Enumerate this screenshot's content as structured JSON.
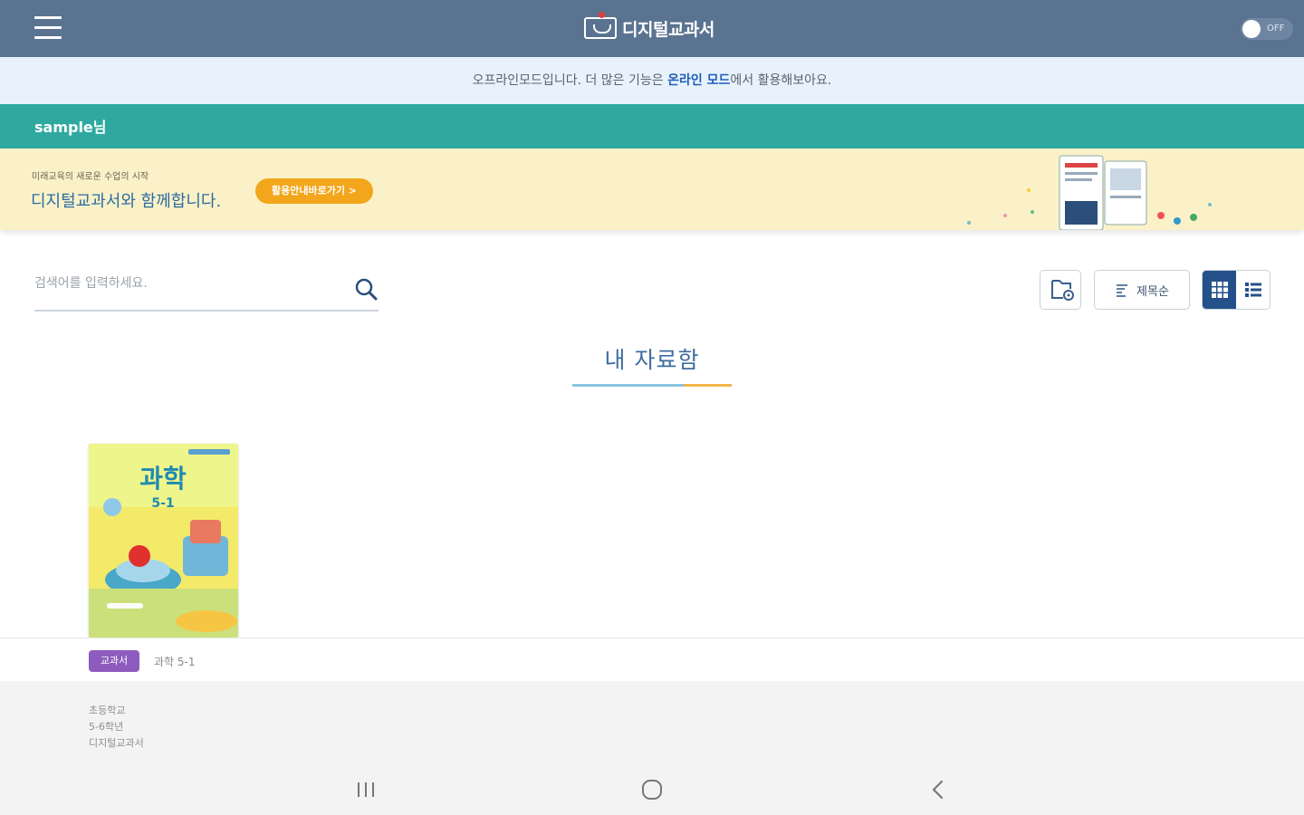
{
  "header": {
    "app_title": "디지털교과서",
    "toggle_label": "OFF"
  },
  "notice": {
    "prefix": "오프라인모드입니다. 더 많은 기능은 ",
    "link": "온라인 모드",
    "suffix": "에서 활용해보아요."
  },
  "user": {
    "name": "sample님"
  },
  "banner": {
    "small_text": "미래교육의 새로운 수업의 시작",
    "headline": "디지털교과서와 함께합니다.",
    "cta": "활용안내바로가기 >"
  },
  "search": {
    "placeholder": "검색어를 입력하세요."
  },
  "toolbar": {
    "sort_label": "제목순",
    "view_mode": "grid"
  },
  "section": {
    "title": "내 자료함"
  },
  "books": [
    {
      "cover_title": "과학",
      "cover_grade": "5-1",
      "badge": "교과서",
      "name": "과학 5-1",
      "details": [
        "초등학교",
        "5-6학년",
        "디지털교과서"
      ]
    }
  ],
  "colors": {
    "topbar": "#5a7390",
    "userbar": "#2fa9a0",
    "notice_bg": "#e8f2fc",
    "banner_bg": "#fbf1c8",
    "badge": "#8e5bbf",
    "active_view": "#24518a"
  }
}
